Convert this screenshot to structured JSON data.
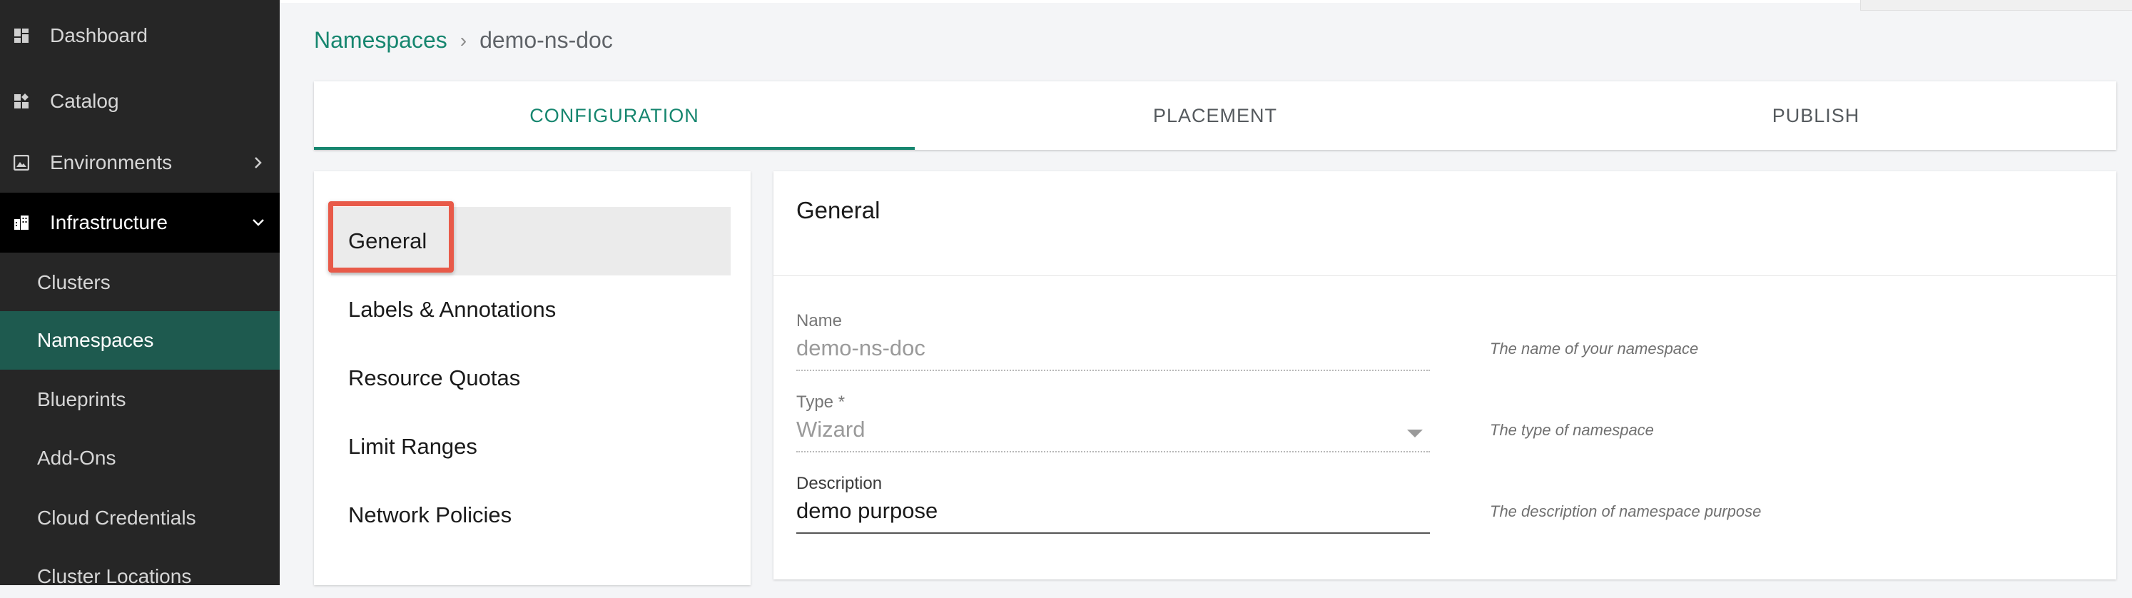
{
  "sidebar": {
    "items": [
      {
        "label": "Dashboard",
        "icon": "dashboard-icon"
      },
      {
        "label": "Catalog",
        "icon": "catalog-icon"
      },
      {
        "label": "Environments",
        "icon": "image-icon"
      },
      {
        "label": "Infrastructure",
        "icon": "building-icon"
      },
      {
        "label": "Clusters"
      },
      {
        "label": "Namespaces"
      },
      {
        "label": "Blueprints"
      },
      {
        "label": "Add-Ons"
      },
      {
        "label": "Cloud Credentials"
      },
      {
        "label": "Cluster Locations"
      }
    ]
  },
  "breadcrumb": {
    "parent": "Namespaces",
    "separator": "›",
    "current": "demo-ns-doc"
  },
  "tabs": [
    {
      "label": "CONFIGURATION",
      "active": true
    },
    {
      "label": "PLACEMENT"
    },
    {
      "label": "PUBLISH"
    }
  ],
  "left_menu": [
    {
      "label": "General",
      "selected": true
    },
    {
      "label": "Labels & Annotations"
    },
    {
      "label": "Resource Quotas"
    },
    {
      "label": "Limit Ranges"
    },
    {
      "label": "Network Policies"
    }
  ],
  "general": {
    "title": "General",
    "fields": {
      "name": {
        "label": "Name",
        "value": "demo-ns-doc",
        "helper": "The name of your namespace"
      },
      "type": {
        "label": "Type *",
        "value": "Wizard",
        "helper": "The type of namespace"
      },
      "description": {
        "label": "Description",
        "value": "demo purpose",
        "helper": "The description of namespace purpose"
      }
    }
  },
  "colors": {
    "accent": "#16866f",
    "sidebar_bg": "#262626",
    "sidebar_active": "#1e5a4f",
    "highlight_box": "#e85a49"
  }
}
